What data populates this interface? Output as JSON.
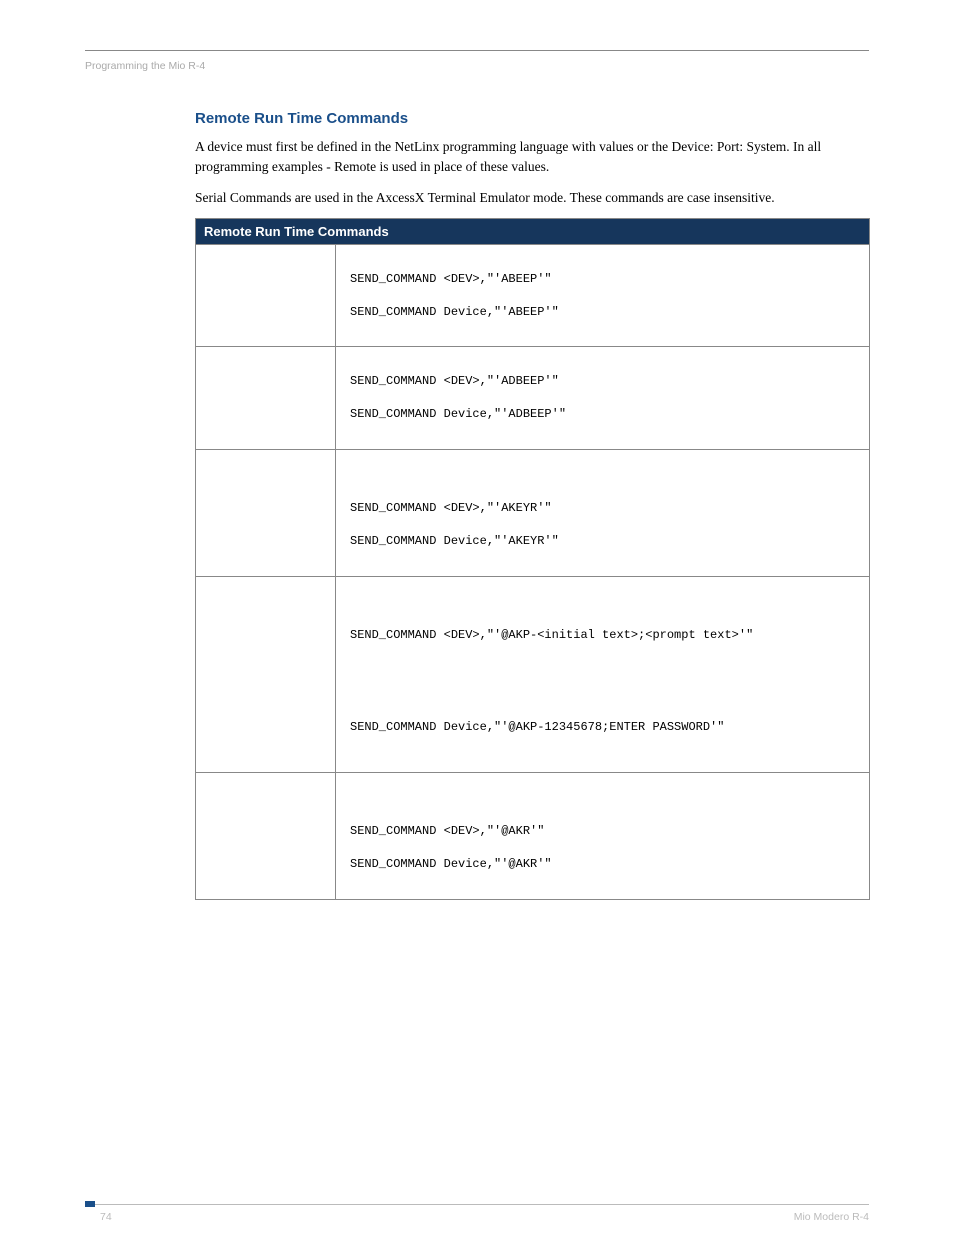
{
  "header": {
    "running_title": "Programming the Mio R-4"
  },
  "section": {
    "heading": "Remote Run Time Commands",
    "para1": "A device must first be defined in the NetLinx programming language with values or the Device: Port: System. In all programming examples - Remote is used in place of these values.",
    "para2": "Serial Commands are used in the AxcessX Terminal Emulator mode. These commands are case insensitive."
  },
  "table": {
    "title": "Remote Run Time Commands",
    "rows": [
      {
        "syntax": "SEND_COMMAND <DEV>,\"'ABEEP'\"",
        "example": "SEND_COMMAND Device,\"'ABEEP'\""
      },
      {
        "syntax": "SEND_COMMAND <DEV>,\"'ADBEEP'\"",
        "example": "SEND_COMMAND Device,\"'ADBEEP'\""
      },
      {
        "syntax": "SEND_COMMAND <DEV>,\"'AKEYR'\"",
        "example": "SEND_COMMAND Device,\"'AKEYR'\""
      },
      {
        "syntax": "SEND_COMMAND <DEV>,\"'@AKP-<initial text>;<prompt text>'\"",
        "example": "SEND_COMMAND Device,\"'@AKP-12345678;ENTER PASSWORD'\""
      },
      {
        "syntax": "SEND_COMMAND <DEV>,\"'@AKR'\"",
        "example": "SEND_COMMAND Device,\"'@AKR'\""
      }
    ]
  },
  "footer": {
    "page_number": "74",
    "doc_title": "Mio Modero R-4"
  }
}
